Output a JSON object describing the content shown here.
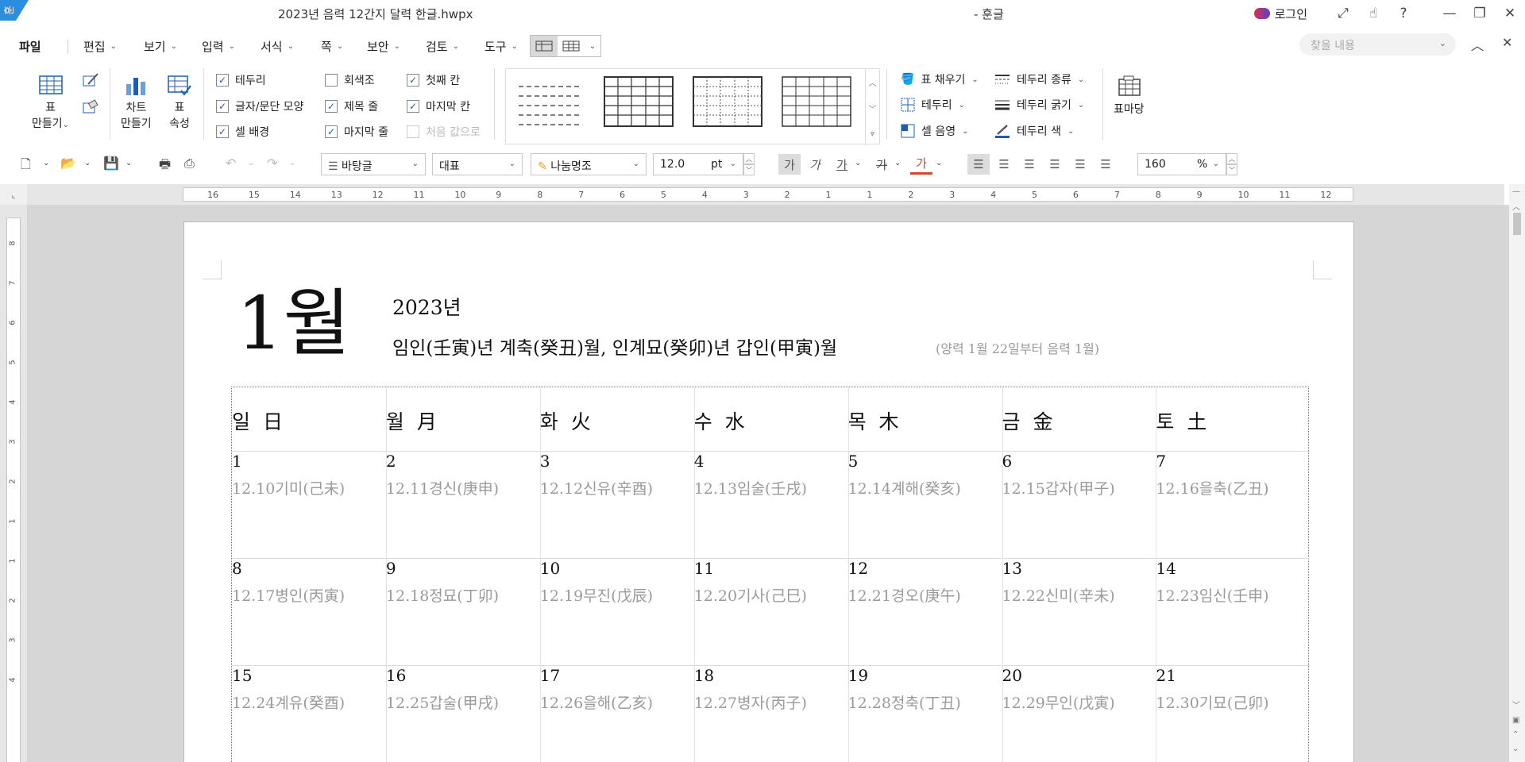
{
  "window": {
    "title": "2023년 음력 12간지 달력 한글.hwpx",
    "app_name": "- 훈글",
    "login_label": "로그인",
    "help_label": "?"
  },
  "menu": {
    "file": "파일",
    "items": [
      "편집",
      "보기",
      "입력",
      "서식",
      "쪽",
      "보안",
      "검토",
      "도구"
    ],
    "search_placeholder": "찾을 내용"
  },
  "ribbon": {
    "make_table": [
      "표",
      "만들기"
    ],
    "make_chart": [
      "차트",
      "만들기"
    ],
    "table_props": [
      "표",
      "속성"
    ],
    "checks": [
      {
        "label": "테두리",
        "checked": true
      },
      {
        "label": "글자/문단 모양",
        "checked": true
      },
      {
        "label": "셀 배경",
        "checked": true
      },
      {
        "label": "회색조",
        "checked": false
      },
      {
        "label": "제목 줄",
        "checked": true
      },
      {
        "label": "마지막 줄",
        "checked": true
      },
      {
        "label": "첫째 칸",
        "checked": true
      },
      {
        "label": "마지막 칸",
        "checked": true
      },
      {
        "label": "처음 값으로",
        "checked": false
      }
    ],
    "fill_label": "표 채우기",
    "border_label": "테두리",
    "cell_shade_label": "셀 음영",
    "border_type_label": "테두리 종류",
    "border_width_label": "테두리 굵기",
    "border_color_label": "테두리 색",
    "table_yard_label": "표마당"
  },
  "toolbar": {
    "style": "바탕글",
    "representative": "대표",
    "font": "나눔명조",
    "size": "12.0",
    "size_unit": "pt",
    "zoom": "160",
    "zoom_unit": "%",
    "char_bold": "가",
    "char_italic": "가",
    "char_underline": "가",
    "char_strike": "가",
    "char_color": "가"
  },
  "ruler": {
    "h_numbers": [
      "16",
      "15",
      "14",
      "13",
      "12",
      "11",
      "10",
      "9",
      "8",
      "7",
      "6",
      "5",
      "4",
      "3",
      "2",
      "1",
      "1",
      "2",
      "3",
      "4",
      "5",
      "6",
      "7",
      "8",
      "9",
      "10",
      "11",
      "12"
    ],
    "v_numbers": [
      "8",
      "7",
      "6",
      "5",
      "4",
      "3",
      "2",
      "1",
      "1",
      "2",
      "3",
      "4"
    ]
  },
  "calendar": {
    "month": "1월",
    "year": "2023년",
    "ganji": "임인(壬寅)년 계축(癸丑)월, 인계묘(癸卯)년 갑인(甲寅)월",
    "note": "(양력 1월 22일부터 음력 1월)",
    "weekdays": [
      "일 日",
      "월 月",
      "화 火",
      "수 水",
      "목 木",
      "금 金",
      "토 土"
    ],
    "weeks": [
      [
        {
          "day": "1",
          "lunar": "12.10기미(己未)"
        },
        {
          "day": "2",
          "lunar": "12.11경신(庚申)"
        },
        {
          "day": "3",
          "lunar": "12.12신유(辛酉)"
        },
        {
          "day": "4",
          "lunar": "12.13임술(壬戌)"
        },
        {
          "day": "5",
          "lunar": "12.14계해(癸亥)"
        },
        {
          "day": "6",
          "lunar": "12.15갑자(甲子)"
        },
        {
          "day": "7",
          "lunar": "12.16을축(乙丑)"
        }
      ],
      [
        {
          "day": "8",
          "lunar": "12.17병인(丙寅)"
        },
        {
          "day": "9",
          "lunar": "12.18정묘(丁卯)"
        },
        {
          "day": "10",
          "lunar": "12.19무진(戊辰)"
        },
        {
          "day": "11",
          "lunar": "12.20기사(己巳)"
        },
        {
          "day": "12",
          "lunar": "12.21경오(庚午)"
        },
        {
          "day": "13",
          "lunar": "12.22신미(辛未)"
        },
        {
          "day": "14",
          "lunar": "12.23임신(壬申)"
        }
      ],
      [
        {
          "day": "15",
          "lunar": "12.24계유(癸酉)"
        },
        {
          "day": "16",
          "lunar": "12.25갑술(甲戌)"
        },
        {
          "day": "17",
          "lunar": "12.26을해(乙亥)"
        },
        {
          "day": "18",
          "lunar": "12.27병자(丙子)"
        },
        {
          "day": "19",
          "lunar": "12.28정축(丁丑)"
        },
        {
          "day": "20",
          "lunar": "12.29무인(戊寅)"
        },
        {
          "day": "21",
          "lunar": "12.30기묘(己卯)"
        }
      ]
    ]
  },
  "colors": {
    "accent": "#1f5db5",
    "table_border": "#d24a5a",
    "lunar_text": "#9a9a9a"
  }
}
